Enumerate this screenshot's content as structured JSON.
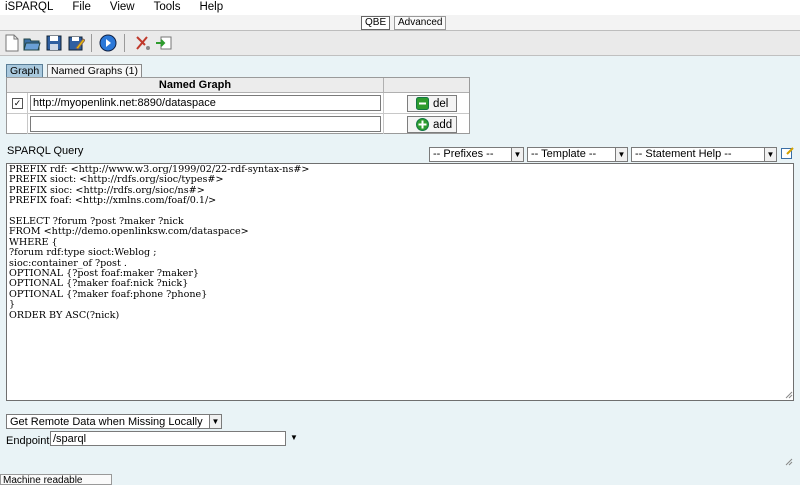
{
  "menu": [
    "iSPARQL",
    "File",
    "View",
    "Tools",
    "Help"
  ],
  "view_tabs": {
    "qbe": "QBE",
    "advanced": "Advanced"
  },
  "toolbar_icons": [
    "new-document-icon",
    "open-folder-icon",
    "save-icon",
    "save-as-icon",
    "run-query-icon",
    "clear-icon",
    "load-icon"
  ],
  "graph_tabs": {
    "graph": "Graph",
    "named_graphs": "Named Graphs (1)"
  },
  "named_graph_table": {
    "header": "Named Graph",
    "rows": [
      {
        "checked": true,
        "value": "http://myopenlink.net:8890/dataspace",
        "action": "del"
      },
      {
        "checked": false,
        "value": "",
        "action": "add"
      }
    ]
  },
  "query_label": "SPARQL Query",
  "dropdowns": {
    "prefixes": "-- Prefixes --",
    "template": "-- Template --",
    "statement_help": "-- Statement Help --"
  },
  "query_text": "PREFIX rdf: <http://www.w3.org/1999/02/22-rdf-syntax-ns#>\nPREFIX sioct: <http://rdfs.org/sioc/types#>\nPREFIX sioc: <http://rdfs.org/sioc/ns#>\nPREFIX foaf: <http://xmlns.com/foaf/0.1/>\n\nSELECT ?forum ?post ?maker ?nick\nFROM <http://demo.openlinksw.com/dataspace>\nWHERE {\n?forum rdf:type sioct:Weblog ;\nsioc:container_of ?post .\nOPTIONAL {?post foaf:maker ?maker}\nOPTIONAL {?maker foaf:nick ?nick}\nOPTIONAL {?maker foaf:phone ?phone}\n}\nORDER BY ASC(?nick)",
  "remote_data_option": "Get Remote Data when Missing Locally",
  "endpoint": {
    "label": "Endpoint",
    "value": "/sparql"
  },
  "bottom_tab": "Machine readable",
  "colors": {
    "background": "#e9f3f6",
    "selected_tab": "#a9c9de",
    "add_icon": "#2e9c2e"
  }
}
